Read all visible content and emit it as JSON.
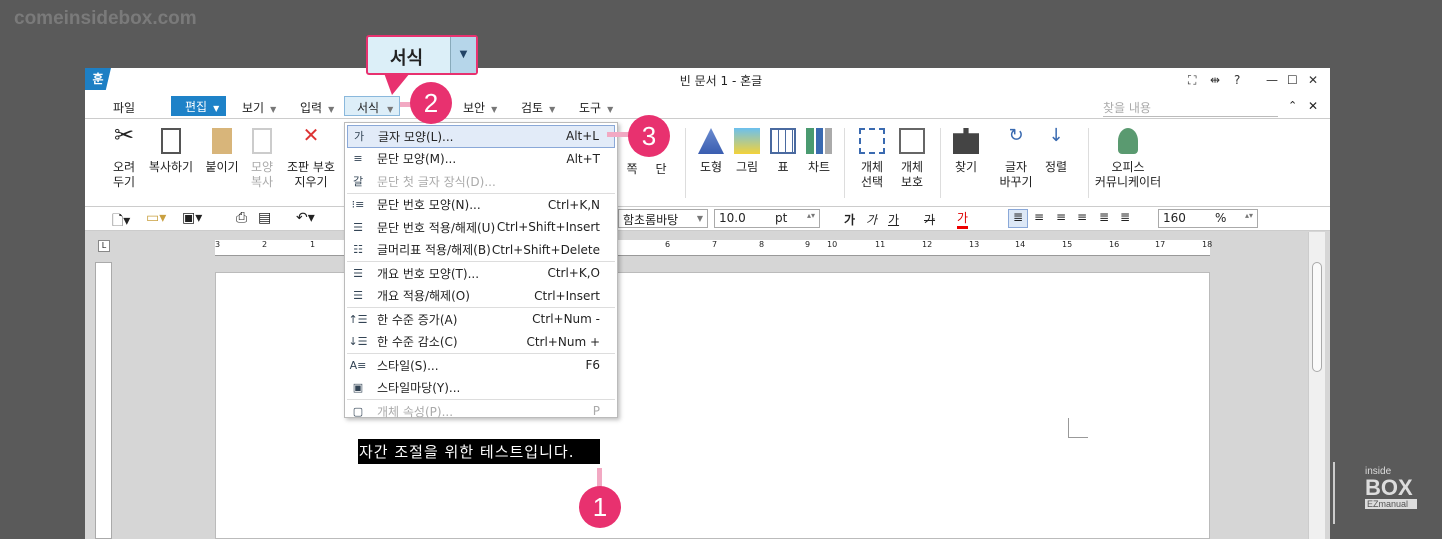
{
  "watermark": "comeinsidebox.com",
  "callout": {
    "label": "서식"
  },
  "window": {
    "logo": "훈",
    "title": "빈 문서 1 - 혼글",
    "controls": [
      "⛶",
      "⇹",
      "?",
      "—",
      "☐",
      "✕"
    ]
  },
  "menubar": {
    "items": [
      "파일",
      "편집",
      "보기",
      "입력",
      "서식",
      "보안",
      "검토",
      "도구"
    ],
    "search_placeholder": "찾을 내용"
  },
  "ribbon": [
    {
      "label": "오려\n두기"
    },
    {
      "label": "복사하기"
    },
    {
      "label": "붙이기"
    },
    {
      "label": "모양\n복사"
    },
    {
      "label": "조판 부호\n지우기"
    },
    {
      "label": "쪽"
    },
    {
      "label": "단"
    },
    {
      "label": "도형"
    },
    {
      "label": "그림"
    },
    {
      "label": "표"
    },
    {
      "label": "차트"
    },
    {
      "label": "개체\n선택"
    },
    {
      "label": "개체\n보호"
    },
    {
      "label": "찾기"
    },
    {
      "label": "글자\n바꾸기"
    },
    {
      "label": "정렬"
    },
    {
      "label": "오피스\n커뮤니케이터"
    }
  ],
  "toolbar": {
    "font": "함초롬바탕",
    "size": "10.0",
    "unit": "pt",
    "styles": [
      "가",
      "가",
      "가",
      "가",
      "가"
    ],
    "zoom": "160",
    "zoom_unit": "%"
  },
  "ruler": {
    "h": [
      "3",
      "2",
      "1",
      "6",
      "7",
      "8",
      "9",
      "10",
      "11",
      "12",
      "13",
      "14",
      "15",
      "16",
      "17",
      "18"
    ]
  },
  "menu": [
    {
      "icon": "가",
      "label": "글자 모양(L)...",
      "shortcut": "Alt+L",
      "hl": true
    },
    {
      "icon": "≡",
      "label": "문단 모양(M)...",
      "shortcut": "Alt+T"
    },
    {
      "icon": "갈",
      "label": "문단 첫 글자 장식(D)...",
      "shortcut": "",
      "dis": true
    },
    {
      "sep": true
    },
    {
      "icon": "⁝≡",
      "label": "문단 번호 모양(N)...",
      "shortcut": "Ctrl+K,N"
    },
    {
      "icon": "☰",
      "label": "문단 번호 적용/해제(U)",
      "shortcut": "Ctrl+Shift+Insert"
    },
    {
      "icon": "☷",
      "label": "글머리표 적용/해제(B)",
      "shortcut": "Ctrl+Shift+Delete"
    },
    {
      "sep": true
    },
    {
      "icon": "☰",
      "label": "개요 번호 모양(T)...",
      "shortcut": "Ctrl+K,O"
    },
    {
      "icon": "☰",
      "label": "개요 적용/해제(O)",
      "shortcut": "Ctrl+Insert"
    },
    {
      "sep": true
    },
    {
      "icon": "↑☰",
      "label": "한 수준 증가(A)",
      "shortcut": "Ctrl+Num -"
    },
    {
      "icon": "↓☰",
      "label": "한 수준 감소(C)",
      "shortcut": "Ctrl+Num +"
    },
    {
      "sep": true
    },
    {
      "icon": "A≡",
      "label": "스타일(S)...",
      "shortcut": "F6"
    },
    {
      "icon": "▣",
      "label": "스타일마당(Y)...",
      "shortcut": ""
    },
    {
      "sep": true
    },
    {
      "icon": "▢",
      "label": "개체 속성(P)...",
      "shortcut": "P",
      "dis": true
    }
  ],
  "document": {
    "selected_text": "자간 조절을 위한 테스트입니다."
  },
  "badges": [
    "1",
    "2",
    "3"
  ],
  "brand": {
    "line1": "inside",
    "line2": "BOX",
    "line3": "EZmanual"
  }
}
